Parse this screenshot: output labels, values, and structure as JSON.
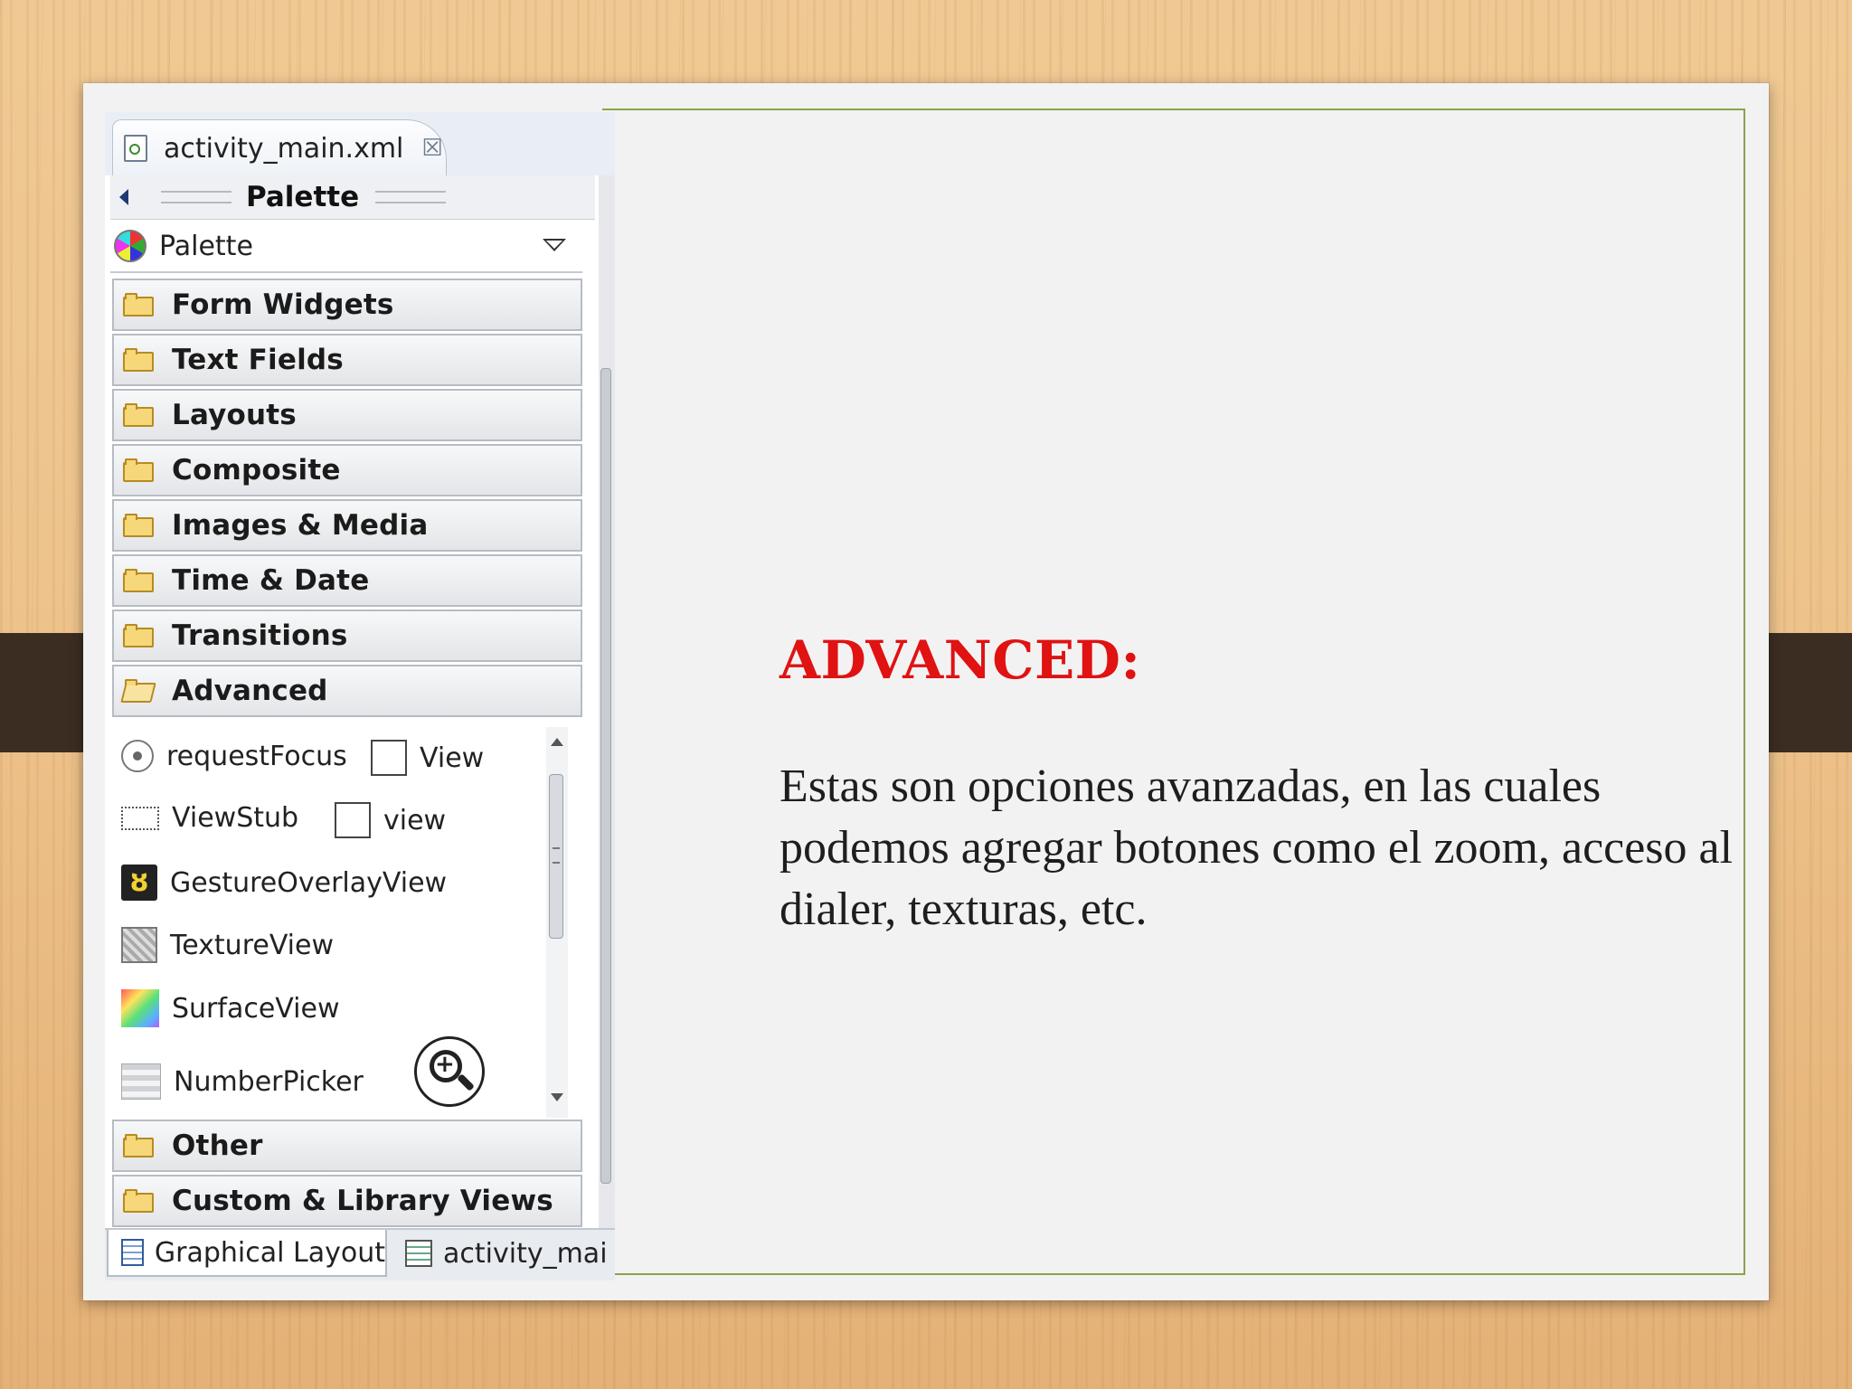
{
  "editor": {
    "file_tab": "activity_main.xml",
    "palette_header": "Palette",
    "palette_select": "Palette",
    "categories": [
      "Form Widgets",
      "Text Fields",
      "Layouts",
      "Composite",
      "Images & Media",
      "Time & Date",
      "Transitions",
      "Advanced",
      "Other",
      "Custom & Library Views"
    ],
    "advanced_items": {
      "request_focus": "requestFocus",
      "view": "View",
      "view_stub": "ViewStub",
      "view_lower": "view",
      "gesture_overlay": "GestureOverlayView",
      "texture_view": "TextureView",
      "surface_view": "SurfaceView",
      "number_picker": "NumberPicker"
    },
    "bottom_tabs": {
      "graphical_layout": "Graphical Layout",
      "xml_tab": "activity_mai"
    }
  },
  "slide": {
    "heading": "ADVANCED:",
    "body": "Estas son opciones avanzadas, en las cuales podemos agregar botones como el zoom, acceso al dialer, texturas, etc.",
    "heading_color": "#e01212",
    "frame_color": "#8aa34a"
  }
}
